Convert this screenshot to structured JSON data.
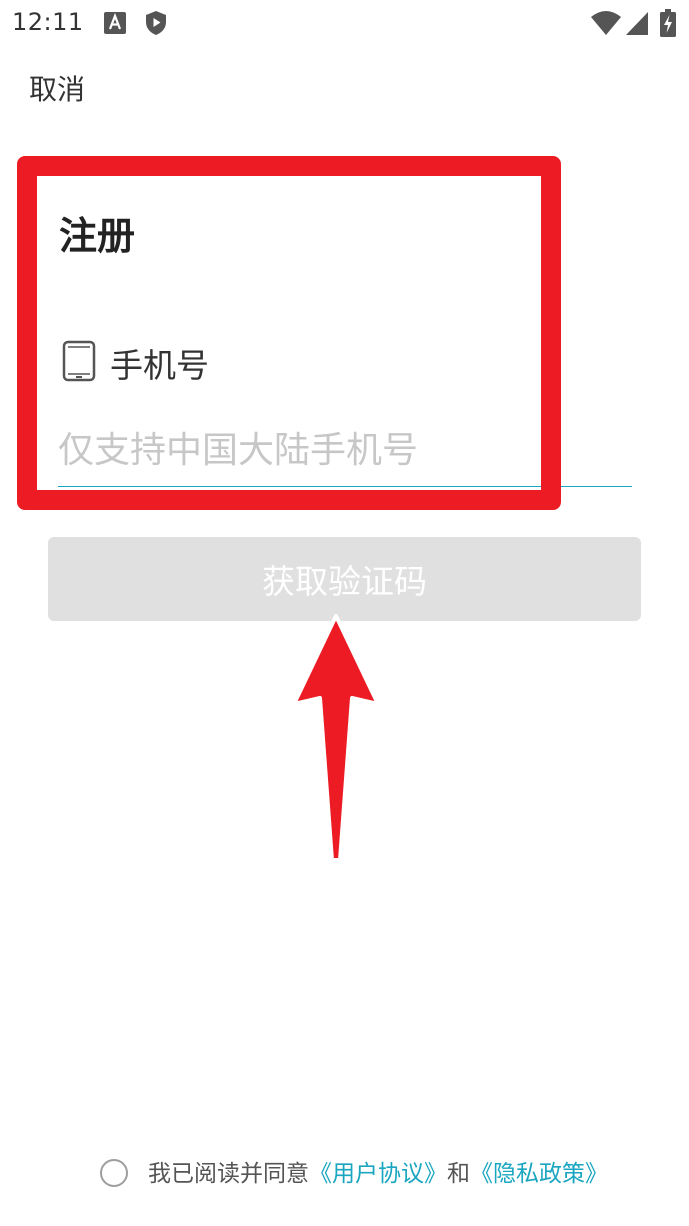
{
  "status_bar": {
    "time": "12:11",
    "icons": [
      "a-icon",
      "shield-play-icon",
      "wifi-icon",
      "signal-icon",
      "battery-charging-icon"
    ]
  },
  "header": {
    "cancel_label": "取消"
  },
  "form": {
    "title": "注册",
    "phone_label": "手机号",
    "phone_placeholder": "仅支持中国大陆手机号",
    "phone_value": "",
    "get_code_label": "获取验证码"
  },
  "agreement": {
    "checked": false,
    "prefix": "我已阅读并同意",
    "user_agreement": "《用户协议》",
    "conjunction": "和",
    "privacy_policy": "《隐私政策》"
  },
  "colors": {
    "accent": "#1aa6c0",
    "annotation_red": "#ed1c24",
    "disabled_button": "#e0e0e0",
    "placeholder": "#c7c7c7"
  }
}
